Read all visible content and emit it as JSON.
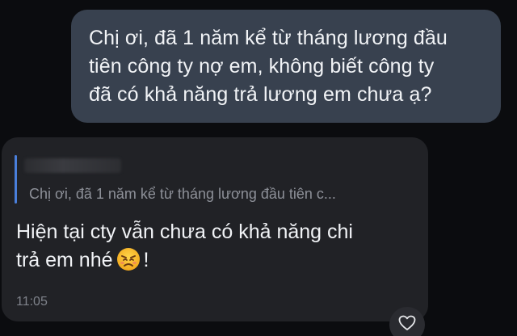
{
  "outgoing_message": {
    "lines": [
      "Chị ơi, đã 1 năm kể từ tháng lương đầu",
      "tiên công ty nợ em, không biết công ty",
      "đã có khả năng trả lương em chưa ạ?"
    ]
  },
  "incoming_message": {
    "quoted_text": "Chị ơi, đã 1 năm kể từ tháng lương đầu tiên c...",
    "line1": "Hiện tại cty vẫn chưa có khả năng chi",
    "line2_before_emoji": "trả em nhé",
    "emoji": "sad-face-emoji",
    "line2_after_emoji": "!",
    "time": "11:05"
  },
  "reaction": {
    "icon": "heart-icon"
  },
  "colors": {
    "background": "#0b0c0f",
    "outgoing_bubble": "#38414f",
    "incoming_bubble": "#212226",
    "quote_accent": "#4a7fdb"
  }
}
